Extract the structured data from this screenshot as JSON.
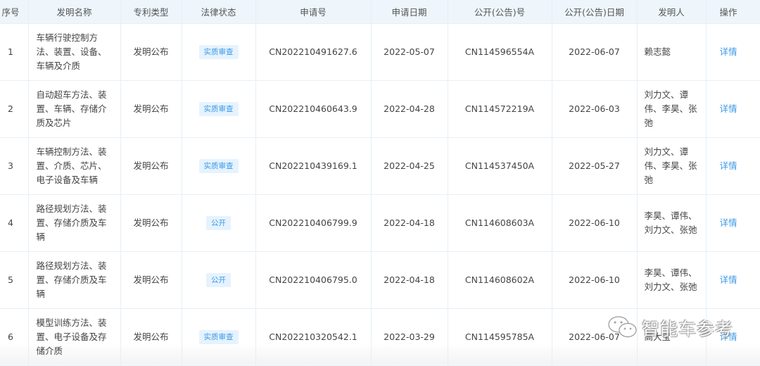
{
  "table": {
    "headers": [
      "序号",
      "发明名称",
      "专利类型",
      "法律状态",
      "申请号",
      "申请日期",
      "公开(公告)号",
      "公开(公告)日期",
      "发明人",
      "操作"
    ],
    "rows": [
      {
        "index": "1",
        "name": "车辆行驶控制方法、装置、设备、车辆及介质",
        "type": "发明公布",
        "status": "实质审查",
        "app_no": "CN202210491627.6",
        "app_date": "2022-05-07",
        "pub_no": "CN114596554A",
        "pub_date": "2022-06-07",
        "inventors": "赖志懿",
        "action": "详情"
      },
      {
        "index": "2",
        "name": "自动超车方法、装置、车辆、存储介质及芯片",
        "type": "发明公布",
        "status": "实质审查",
        "app_no": "CN202210460643.9",
        "app_date": "2022-04-28",
        "pub_no": "CN114572219A",
        "pub_date": "2022-06-03",
        "inventors": "刘力文、谭伟、李昊、张弛",
        "action": "详情"
      },
      {
        "index": "3",
        "name": "车辆控制方法、装置、介质、芯片、电子设备及车辆",
        "type": "发明公布",
        "status": "实质审查",
        "app_no": "CN202210439169.1",
        "app_date": "2022-04-25",
        "pub_no": "CN114537450A",
        "pub_date": "2022-05-27",
        "inventors": "刘力文、谭伟、李昊、张弛",
        "action": "详情"
      },
      {
        "index": "4",
        "name": "路径规划方法、装置、存储介质及车辆",
        "type": "发明公布",
        "status": "公开",
        "app_no": "CN202210406799.9",
        "app_date": "2022-04-18",
        "pub_no": "CN114608603A",
        "pub_date": "2022-06-10",
        "inventors": "李昊、谭伟、刘力文、张弛",
        "action": "详情"
      },
      {
        "index": "5",
        "name": "路径规划方法、装置、存储介质及车辆",
        "type": "发明公布",
        "status": "公开",
        "app_no": "CN202210406795.0",
        "app_date": "2022-04-18",
        "pub_no": "CN114608602A",
        "pub_date": "2022-06-10",
        "inventors": "李昊、谭伟、刘力文、张弛",
        "action": "详情"
      },
      {
        "index": "6",
        "name": "模型训练方法、装置、电子设备及存储介质",
        "type": "发明公布",
        "status": "实质审查",
        "app_no": "CN202210320542.1",
        "app_date": "2022-03-29",
        "pub_no": "CN114595785A",
        "pub_date": "2022-06-07",
        "inventors": "高大宝",
        "action": "详情"
      }
    ]
  },
  "watermark": {
    "icon": "wechat-icon",
    "text": "智能车参考"
  },
  "colors": {
    "header_bg": "#eef6fc",
    "border": "#e6eff7",
    "tag_bg": "#e6f3fe",
    "accent": "#3d99e6"
  }
}
